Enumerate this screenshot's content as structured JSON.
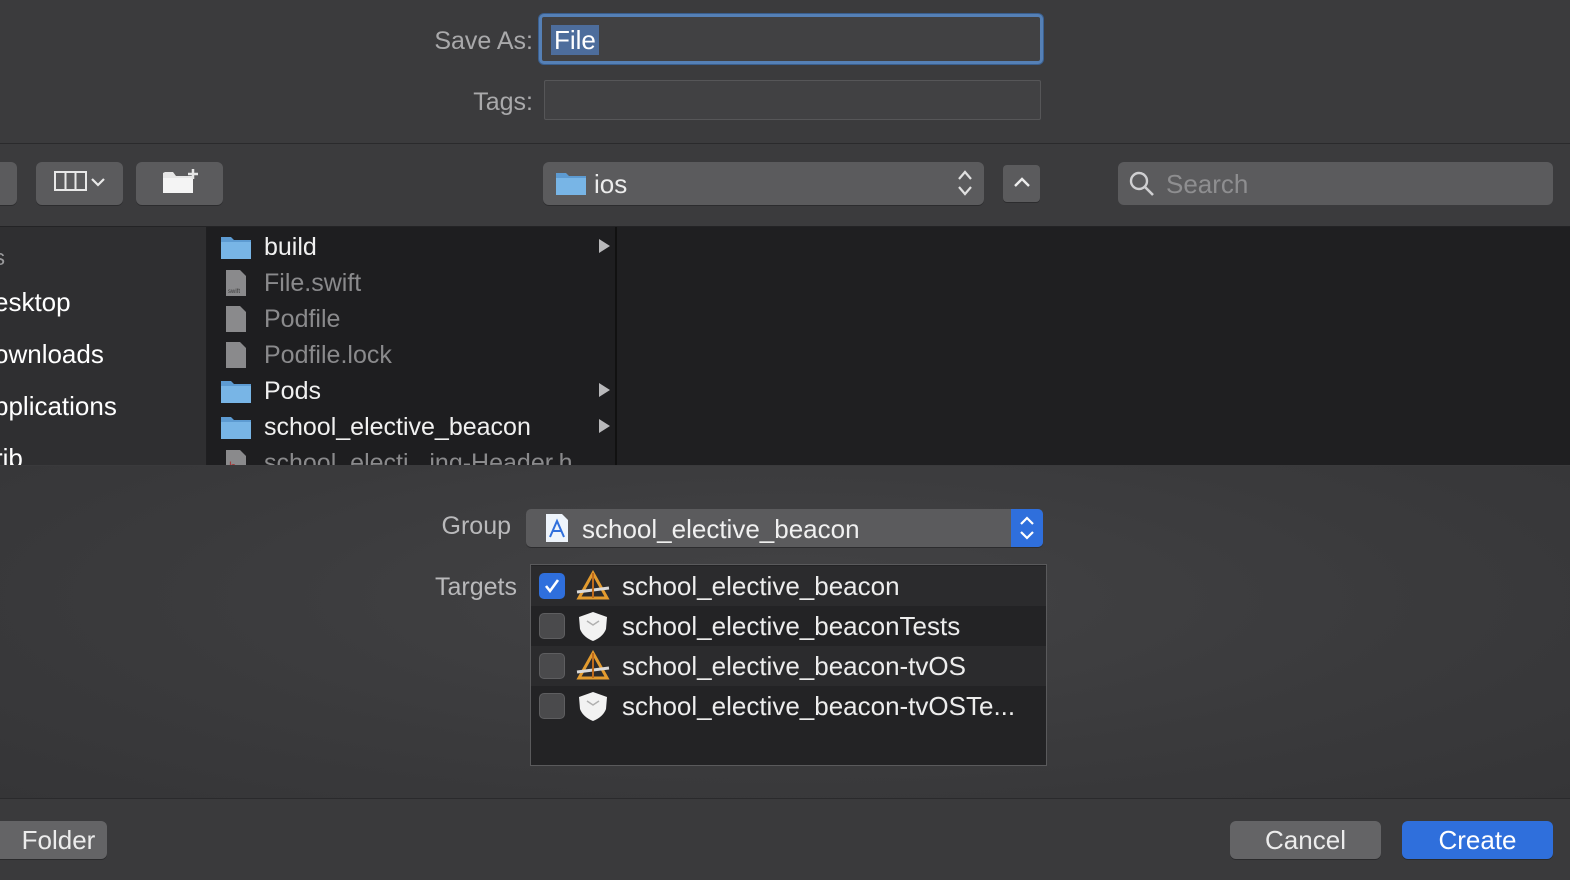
{
  "save_as": {
    "label": "Save As:",
    "value": "File"
  },
  "tags": {
    "label": "Tags:",
    "value": ""
  },
  "toolbar": {
    "view_mode_icon": "columns-view-icon",
    "new_folder_icon": "new-folder-icon",
    "location": "ios",
    "search_placeholder": "Search"
  },
  "sidebar": {
    "heading": "s",
    "items": [
      {
        "label": "esktop"
      },
      {
        "label": "ownloads"
      },
      {
        "label": "pplications"
      },
      {
        "label": "rib"
      }
    ]
  },
  "files": [
    {
      "name": "build",
      "type": "folder",
      "enabled": true,
      "has_children": true
    },
    {
      "name": "File.swift",
      "type": "swift-file",
      "enabled": false,
      "has_children": false
    },
    {
      "name": "Podfile",
      "type": "file",
      "enabled": false,
      "has_children": false
    },
    {
      "name": "Podfile.lock",
      "type": "file",
      "enabled": false,
      "has_children": false
    },
    {
      "name": "Pods",
      "type": "folder",
      "enabled": true,
      "has_children": true
    },
    {
      "name": "school_elective_beacon",
      "type": "folder",
      "enabled": true,
      "has_children": true
    },
    {
      "name": "school_electi...ing-Header.h",
      "type": "header-file",
      "enabled": false,
      "has_children": false
    }
  ],
  "group": {
    "label": "Group",
    "value": "school_elective_beacon"
  },
  "targets": {
    "label": "Targets",
    "items": [
      {
        "name": "school_elective_beacon",
        "checked": true,
        "icon": "app-target-icon"
      },
      {
        "name": "school_elective_beaconTests",
        "checked": false,
        "icon": "test-target-icon"
      },
      {
        "name": "school_elective_beacon-tvOS",
        "checked": false,
        "icon": "app-target-icon"
      },
      {
        "name": "school_elective_beacon-tvOSTe...",
        "checked": false,
        "icon": "test-target-icon"
      }
    ]
  },
  "buttons": {
    "new_folder": "Folder",
    "cancel": "Cancel",
    "create": "Create"
  },
  "colors": {
    "accent": "#2f6fdc",
    "focus_ring": "#5580b6",
    "folder": "#6aa6d8"
  }
}
